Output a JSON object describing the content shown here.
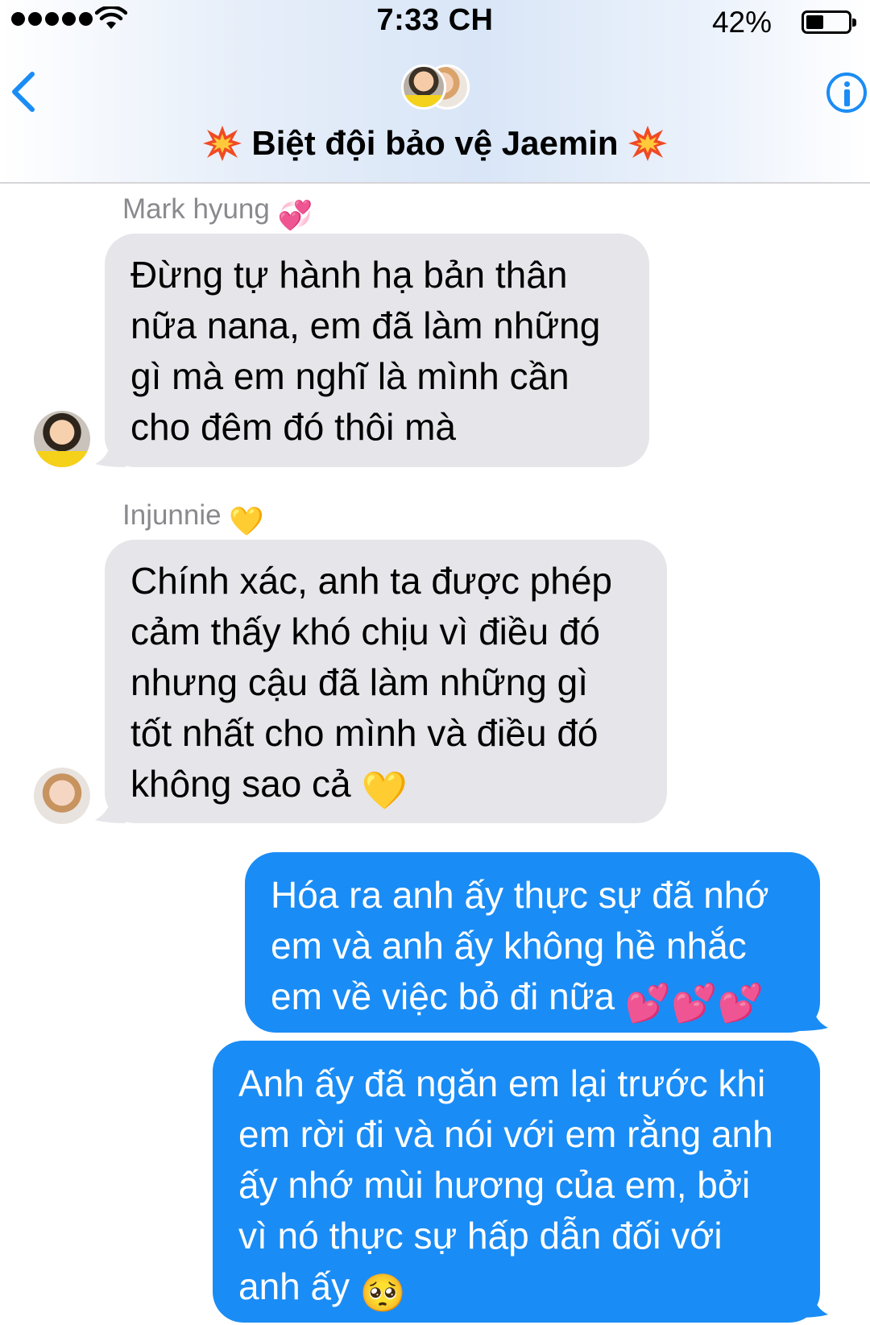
{
  "status_bar": {
    "time": "7:33 CH",
    "battery_percent": "42%",
    "battery_level": 0.42,
    "signal_icon": "signal-dots-icon",
    "wifi_icon": "wifi-icon"
  },
  "header": {
    "title": "Biệt đội bảo vệ Jaemin",
    "title_emoji": "collision-icon",
    "back_icon": "chevron-left-icon",
    "info_icon": "info-icon"
  },
  "messages": [
    {
      "direction": "incoming",
      "sender": "Mark hyung",
      "sender_emoji": "💞",
      "lines": [
        "Đừng tự hành hạ bản thân",
        "nữa nana, em đã làm những",
        "gì mà em nghĩ là mình cần",
        "cho đêm đó thôi mà"
      ]
    },
    {
      "direction": "incoming",
      "sender": "Injunnie",
      "sender_emoji": "💛",
      "lines": [
        "Chính xác, anh ta được phép",
        "cảm thấy khó chịu vì điều đó",
        "nhưng cậu đã làm những gì",
        "tốt nhất cho mình và điều đó",
        "không sao cả"
      ],
      "trailing_emoji": "💛"
    },
    {
      "direction": "outgoing",
      "lines": [
        "Hóa ra anh ấy thực sự đã nhớ",
        "em và anh ấy không hề nhắc",
        "em về việc bỏ đi nữa"
      ],
      "trailing_emoji": "💕💕💕"
    },
    {
      "direction": "outgoing",
      "lines": [
        "Anh ấy đã ngăn em lại trước khi",
        "em rời đi và nói với em rằng anh",
        "ấy nhớ mùi hương của em, bởi",
        "vì nó thực sự hấp dẫn đối với",
        "anh ấy"
      ],
      "trailing_emoji": "🥺"
    }
  ],
  "colors": {
    "incoming_bubble": "#e5e5ea",
    "outgoing_bubble": "#1a8cf5",
    "accent": "#1a8cf5",
    "sender_name": "#8a8a8e"
  }
}
